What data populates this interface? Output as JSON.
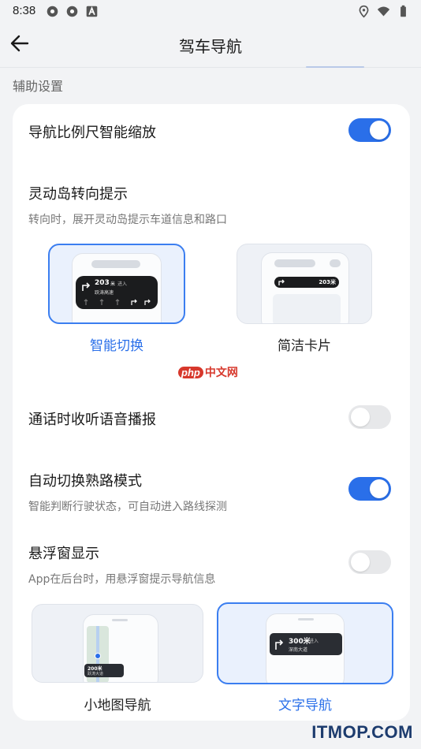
{
  "status_bar": {
    "time": "8:38"
  },
  "header": {
    "title": "驾车导航"
  },
  "section": {
    "title": "辅助设置"
  },
  "settings": {
    "smart_zoom": {
      "title": "导航比例尺智能缩放",
      "enabled": true
    },
    "island": {
      "title": "灵动岛转向提示",
      "subtitle": "转向时，展开灵动岛提示车道信息和路口",
      "options": [
        {
          "label": "智能切换",
          "selected": true,
          "preview_distance": "203",
          "preview_unit": "米",
          "preview_action": "进入",
          "preview_road": "跃涛高速"
        },
        {
          "label": "简洁卡片",
          "selected": false,
          "preview_distance": "203米"
        }
      ]
    },
    "call_voice": {
      "title": "通话时收听语音播报",
      "enabled": false
    },
    "familiar_route": {
      "title": "自动切换熟路模式",
      "subtitle": "智能判断行驶状态，可自动进入路线探测",
      "enabled": true
    },
    "float_window": {
      "title": "悬浮窗显示",
      "subtitle": "App在后台时，用悬浮窗提示导航信息",
      "enabled": false,
      "options": [
        {
          "label": "小地图导航",
          "selected": false,
          "preview_distance": "200米",
          "preview_road": "跃涛大道"
        },
        {
          "label": "文字导航",
          "selected": true,
          "preview_distance": "300米",
          "preview_action": "进入",
          "preview_road": "深南大道"
        }
      ]
    }
  },
  "watermark": {
    "logo": "php",
    "text": "中文网"
  },
  "footer": {
    "brand": "ITMOP.COM"
  },
  "colors": {
    "accent": "#2a6fe9",
    "background": "#f2f3f5",
    "card": "#ffffff"
  }
}
